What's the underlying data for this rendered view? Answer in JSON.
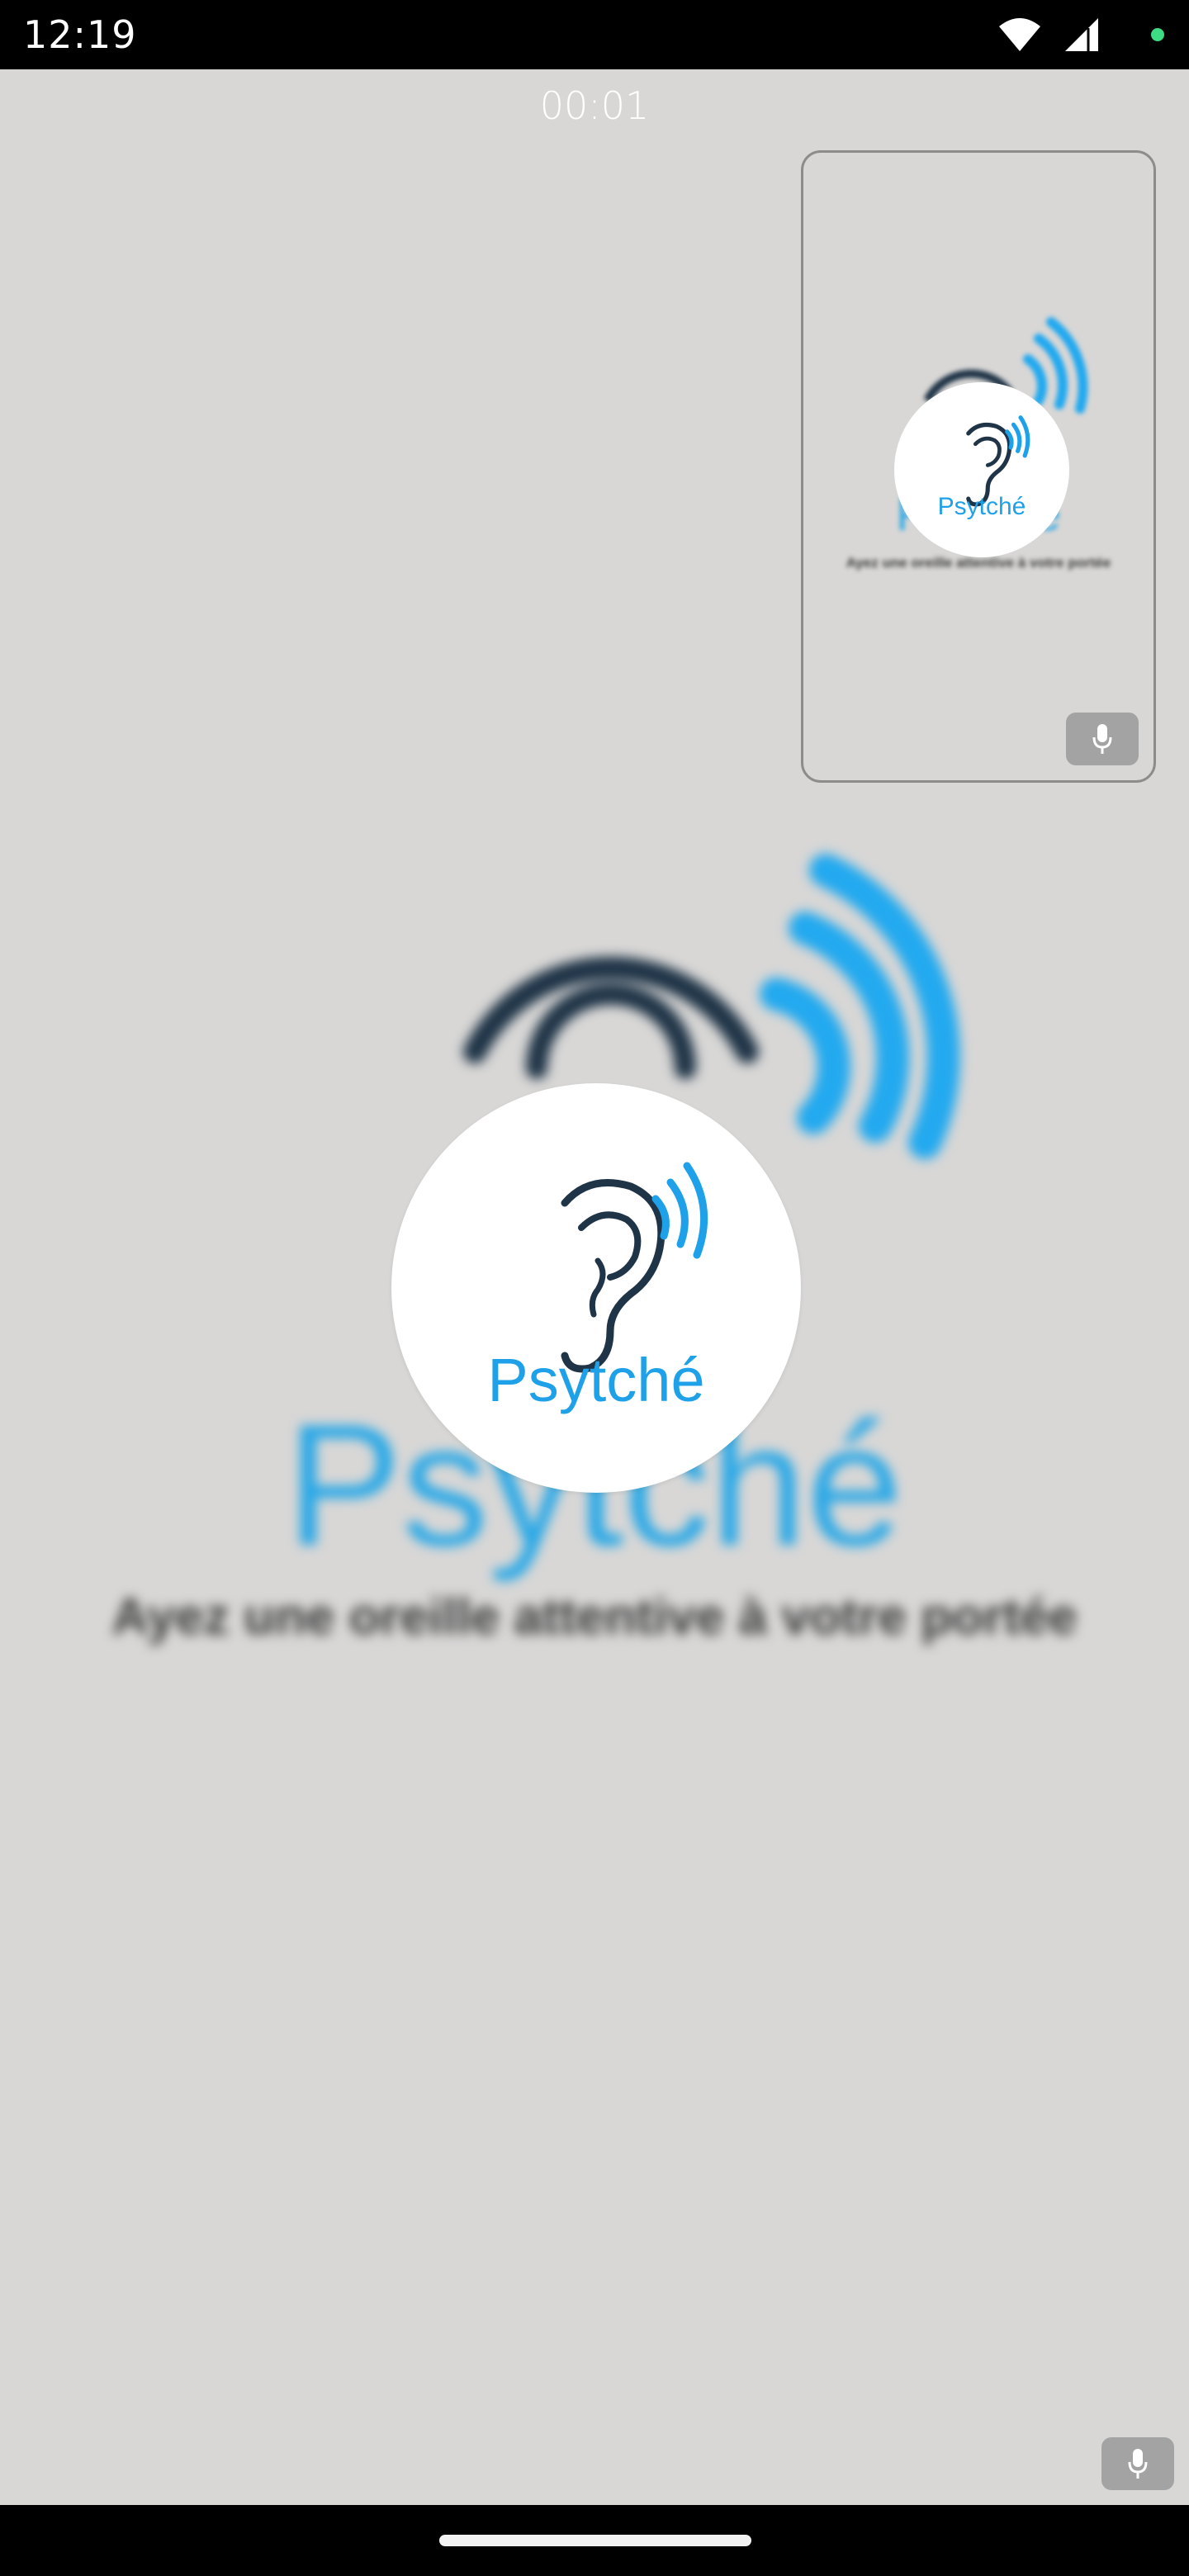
{
  "status_bar": {
    "time": "12:19",
    "icons": [
      "wifi-icon",
      "signal-icon",
      "privacy-indicator-dot"
    ]
  },
  "call": {
    "timer": "00:01"
  },
  "remote_video": {
    "brand": "Psytché",
    "tagline": "Ayez une oreille attentive à votre portée",
    "avatar_brand": "Psytché"
  },
  "self_preview": {
    "brand": "Psytché",
    "tagline": "Ayez une oreille attentive à votre portée",
    "avatar_brand": "Psytché"
  },
  "colors": {
    "background": "#d8d7d6",
    "brand_blue": "#1ea1e8",
    "ear_dark": "#1f3447",
    "chip_gray": "#a3a3a3"
  }
}
